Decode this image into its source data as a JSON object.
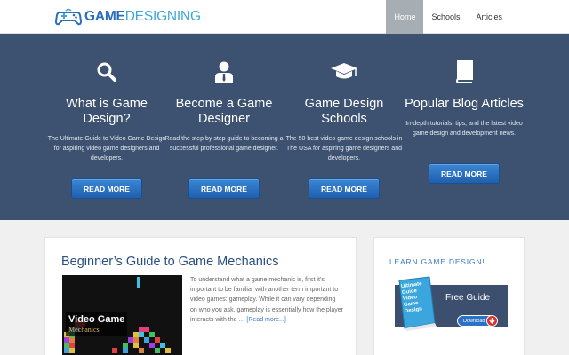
{
  "header": {
    "logo_part1": "GAME",
    "logo_part2": "DESIGNING",
    "nav": [
      {
        "label": "Home",
        "active": true
      },
      {
        "label": "Schools",
        "active": false
      },
      {
        "label": "Articles",
        "active": false
      }
    ]
  },
  "features": [
    {
      "icon": "search-icon",
      "title": "What is Game Design?",
      "desc": "The Ultimate Guide to Video Game Design for aspiring video game designers and developers.",
      "button": "READ MORE"
    },
    {
      "icon": "user-icon",
      "title": "Become a Game Designer",
      "desc": "Read the step by step guide to becoming a successful professional game designer.",
      "button": "READ MORE"
    },
    {
      "icon": "graduation-cap-icon",
      "title": "Game Design Schools",
      "desc": "The 50 best video game design schools in The USA for aspiring game designers and developers.",
      "button": "READ MORE"
    },
    {
      "icon": "book-icon",
      "title": "Popular Blog Articles",
      "desc": "In-depth tutorials, tips, and the latest video game design and development news.",
      "button": "READ MORE"
    }
  ],
  "post": {
    "title": "Beginner’s Guide to Game Mechanics",
    "thumb_line1": "Video Game",
    "thumb_line2": "Mechanics",
    "excerpt": "To understand what a game mechanic is, first it’s important to be familiar with another term important to video games: gameplay. While it can vary depending on who you ask, gameplay is essentially how the player interacts with the …",
    "read_more": "[Read more...]"
  },
  "sidebar": {
    "title": "LEARN GAME DESIGN!",
    "book_text": "Ultimate Guide Video Game Design",
    "promo_text": "Free Guide",
    "download": "Download"
  },
  "colors": {
    "hero_bg": "#3d5170",
    "accent": "#3a7bc8",
    "button": "#2a6fc2",
    "nav_active": "#a6adb3"
  }
}
